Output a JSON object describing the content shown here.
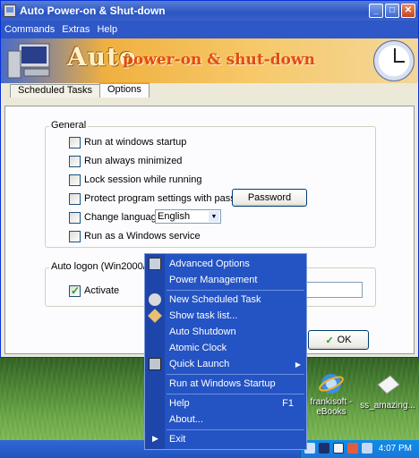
{
  "window": {
    "title": "Auto Power-on & Shut-down",
    "buttons": {
      "minimize": "_",
      "maximize": "□",
      "close": "✕"
    }
  },
  "menubar": [
    "Commands",
    "Extras",
    "Help"
  ],
  "banner": {
    "word1": "Auto",
    "word2": "power-on & shut-down"
  },
  "tabs": [
    {
      "label": "Scheduled Tasks",
      "active": false
    },
    {
      "label": "Options",
      "active": true
    }
  ],
  "general": {
    "label": "General",
    "options": [
      {
        "label": "Run at windows startup",
        "checked": false
      },
      {
        "label": "Run always minimized",
        "checked": false
      },
      {
        "label": "Lock session while running",
        "checked": false
      },
      {
        "label": "Protect program settings with password",
        "checked": false
      },
      {
        "label": "Change language",
        "checked": false
      },
      {
        "label": "Run as a Windows service",
        "checked": false
      }
    ],
    "password_button": "Password",
    "language_value": "English"
  },
  "autologon": {
    "label": "Auto logon (Win2000/XP,",
    "activate_label": "Activate",
    "activate_checked": true
  },
  "ok_button": "OK",
  "context_menu": {
    "items": [
      {
        "label": "Advanced Options",
        "icon": "window-icon"
      },
      {
        "label": "Power Management",
        "icon": ""
      },
      {
        "label": "New Scheduled Task",
        "icon": "task-icon"
      },
      {
        "label": "Show task list...",
        "icon": "list-icon"
      },
      {
        "label": "Auto Shutdown",
        "icon": ""
      },
      {
        "label": "Atomic Clock",
        "icon": ""
      },
      {
        "label": "Quick Launch",
        "icon": "monitor-icon",
        "submenu": true
      },
      {
        "label": "Run at Windows Startup",
        "icon": ""
      },
      {
        "label": "Help",
        "icon": "",
        "shortcut": "F1"
      },
      {
        "label": "About...",
        "icon": ""
      },
      {
        "label": "Exit",
        "icon": "arrow-icon"
      }
    ]
  },
  "desktop_icons": [
    {
      "label": "frankisoft - eBooks",
      "icon": "ie-icon"
    },
    {
      "label": "ss_amazing...",
      "icon": "image-file-icon"
    }
  ],
  "taskbar": {
    "time": "4:07 PM"
  },
  "colors": {
    "menu_bg": "#2453c3",
    "titlebar": "#2b55c0",
    "tray": "#0f8be8"
  }
}
